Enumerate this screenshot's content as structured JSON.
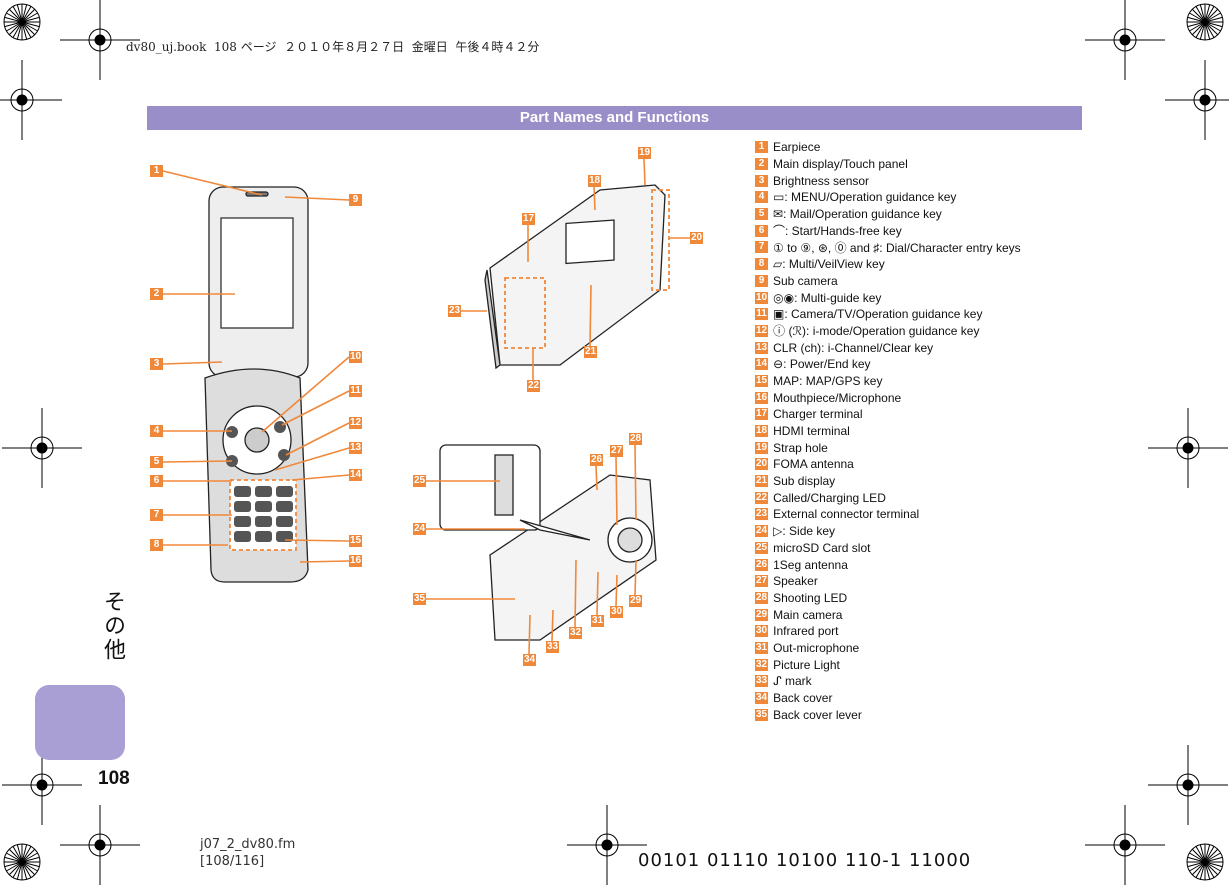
{
  "print_header": "dv80_uj.book  108 ページ  ２０１０年８月２７日  金曜日  午後４時４２分",
  "section_title": "Part Names and Functions",
  "items": [
    {
      "num": "1",
      "text": "Earpiece"
    },
    {
      "num": "2",
      "text": "Main display/Touch panel"
    },
    {
      "num": "3",
      "text": "Brightness sensor"
    },
    {
      "num": "4",
      "text": "▭: MENU/Operation guidance key"
    },
    {
      "num": "5",
      "text": "✉: Mail/Operation guidance key"
    },
    {
      "num": "6",
      "text": "⌒: Start/Hands-free key"
    },
    {
      "num": "7",
      "text": "① to ⑨, ⊛, ⓪ and ♯: Dial/Character entry keys"
    },
    {
      "num": "8",
      "text": "▱: Multi/VeilView key"
    },
    {
      "num": "9",
      "text": "Sub camera"
    },
    {
      "num": "10",
      "text": "◎◉: Multi-guide key"
    },
    {
      "num": "11",
      "text": "▣: Camera/TV/Operation guidance key"
    },
    {
      "num": "12",
      "text": "ⓘ (ℛ): i-mode/Operation guidance key"
    },
    {
      "num": "13",
      "text": "CLR (ch): i-Channel/Clear key"
    },
    {
      "num": "14",
      "text": "⊖: Power/End key"
    },
    {
      "num": "15",
      "text": "MAP: MAP/GPS key"
    },
    {
      "num": "16",
      "text": "Mouthpiece/Microphone"
    },
    {
      "num": "17",
      "text": "Charger terminal"
    },
    {
      "num": "18",
      "text": "HDMI terminal"
    },
    {
      "num": "19",
      "text": "Strap hole"
    },
    {
      "num": "20",
      "text": "FOMA antenna"
    },
    {
      "num": "21",
      "text": "Sub display"
    },
    {
      "num": "22",
      "text": "Called/Charging LED"
    },
    {
      "num": "23",
      "text": "External connector terminal"
    },
    {
      "num": "24",
      "text": "▷: Side key"
    },
    {
      "num": "25",
      "text": "microSD Card slot"
    },
    {
      "num": "26",
      "text": "1Seg antenna"
    },
    {
      "num": "27",
      "text": "Speaker"
    },
    {
      "num": "28",
      "text": "Shooting LED"
    },
    {
      "num": "29",
      "text": "Main camera"
    },
    {
      "num": "30",
      "text": "Infrared port"
    },
    {
      "num": "31",
      "text": "Out-microphone"
    },
    {
      "num": "32",
      "text": "Picture Light"
    },
    {
      "num": "33",
      "text": "ᔑ mark"
    },
    {
      "num": "34",
      "text": "Back cover"
    },
    {
      "num": "35",
      "text": "Back cover lever"
    }
  ],
  "side_tab_label": "その他",
  "page_number": "108",
  "footer": {
    "file": "j07_2_dv80.fm",
    "pages": "[108/116]",
    "code": "00101 01110 10100 110-1 11000"
  },
  "colors": {
    "accent_orange": "#f0883a",
    "section_bar": "#9a8ec8",
    "side_tab": "#a99fd4"
  }
}
